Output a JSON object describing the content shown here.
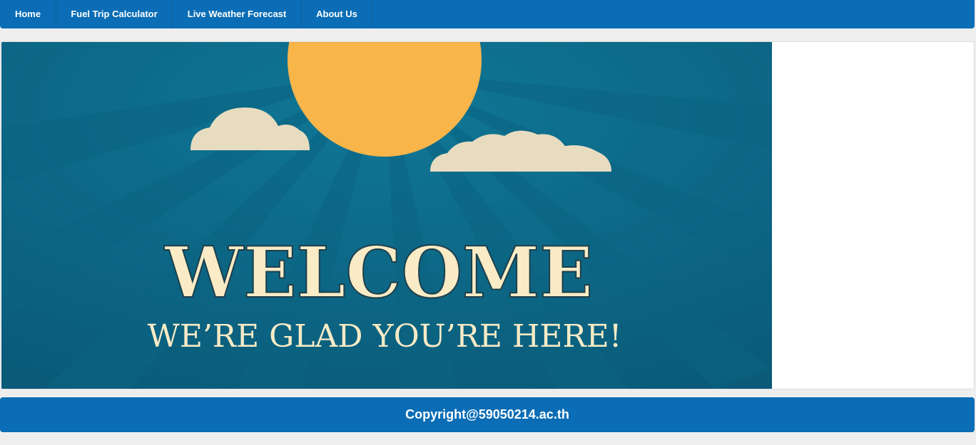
{
  "nav": {
    "items": [
      {
        "label": "Home"
      },
      {
        "label": "Fuel Trip Calculator"
      },
      {
        "label": "Live Weather Forecast"
      },
      {
        "label": "About Us"
      }
    ]
  },
  "banner": {
    "headline": "WELCOME",
    "subline": "WE’RE GLAD YOU’RE HERE!"
  },
  "footer": {
    "copyright": "Copyright@59050214.ac.th"
  },
  "colors": {
    "nav_bg": "#0a6db5",
    "banner_bg": "#0e6a8a",
    "sun": "#f7b54a",
    "cloud": "#e8dcc0",
    "headline_text": "#f8ebc6"
  }
}
